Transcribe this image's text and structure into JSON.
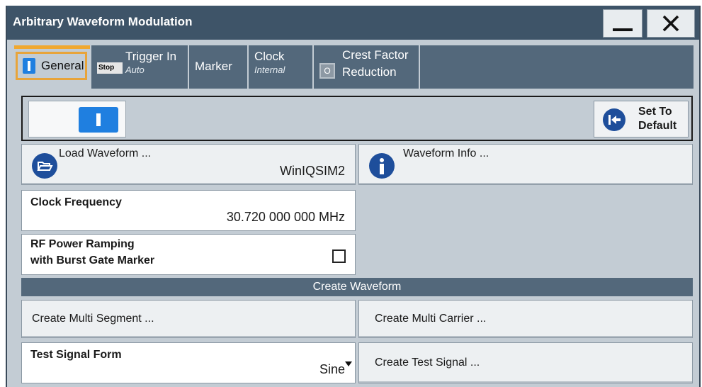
{
  "window": {
    "title": "Arbitrary Waveform Modulation"
  },
  "tabs": [
    {
      "label": "General"
    },
    {
      "label": "Trigger In",
      "sub": "Auto",
      "badge": "Stop"
    },
    {
      "label": "Marker"
    },
    {
      "label": "Clock",
      "sub": "Internal"
    },
    {
      "label": "Crest Factor",
      "label2": "Reduction",
      "badge": "O"
    }
  ],
  "state": {
    "enabled": true
  },
  "set_default": {
    "line1": "Set To",
    "line2": "Default"
  },
  "load_waveform": {
    "label": "Load Waveform ...",
    "value": "WinIQSIM2"
  },
  "waveform_info": {
    "label": "Waveform Info ..."
  },
  "clock_frequency": {
    "label": "Clock Frequency",
    "value": "30.720 000 000 MHz"
  },
  "rf_ramping": {
    "line1": "RF Power Ramping",
    "line2": "with Burst Gate Marker",
    "checked": false
  },
  "create_waveform": {
    "heading": "Create Waveform",
    "multi_segment": "Create Multi Segment ...",
    "multi_carrier": "Create Multi Carrier ...",
    "test_signal_form": {
      "label": "Test Signal Form",
      "value": "Sine"
    },
    "test_signal": "Create Test Signal ..."
  },
  "colors": {
    "accent": "#1f7fe0",
    "titlebar": "#3e5468",
    "tab_bg": "#53687b",
    "active_tab_border": "#e8a43a"
  }
}
